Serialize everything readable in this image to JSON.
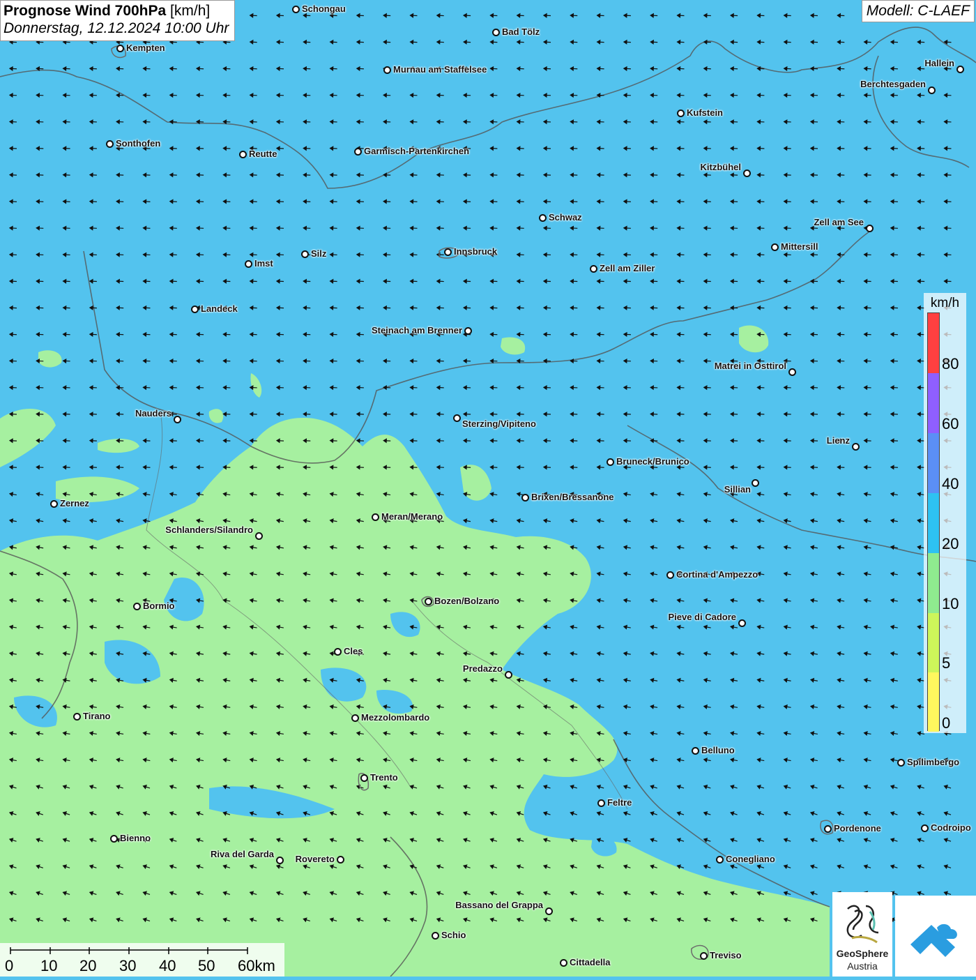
{
  "header": {
    "title_bold": "Prognose Wind 700hPa",
    "title_unit": "[km/h]",
    "datetime": "Donnerstag, 12.12.2024 10:00 Uhr",
    "model": "Modell: C-LAEF"
  },
  "legend": {
    "unit": "km/h",
    "labels": [
      "80",
      "60",
      "40",
      "20",
      "10",
      "5",
      "0"
    ],
    "colors": [
      "#ff4040",
      "#8f5fff",
      "#5b8ff6",
      "#2ec2f2",
      "#8feb8f",
      "#cdf55a",
      "#fff75e"
    ]
  },
  "scalebar": {
    "labels": [
      "0",
      "10",
      "20",
      "30",
      "40",
      "50",
      "60km"
    ]
  },
  "logos": {
    "geosphere_line1": "GeoSphere",
    "geosphere_line2": "Austria"
  },
  "wind": {
    "predominant_direction": "east",
    "field_color_blue": "#53c3ee",
    "field_color_green": "#a6f0a0"
  },
  "cities": [
    {
      "name": "Schongau"
    },
    {
      "name": "Bad Tölz"
    },
    {
      "name": "Kempten"
    },
    {
      "name": "Murnau am Staffelsee"
    },
    {
      "name": "Hallein"
    },
    {
      "name": "Berchtesgaden"
    },
    {
      "name": "Kufstein"
    },
    {
      "name": "Sonthofen"
    },
    {
      "name": "Reutte"
    },
    {
      "name": "Garmisch-Partenkirchen"
    },
    {
      "name": "Kitzbühel"
    },
    {
      "name": "Schwaz"
    },
    {
      "name": "Zell am See"
    },
    {
      "name": "Mittersill"
    },
    {
      "name": "Innsbruck"
    },
    {
      "name": "Silz"
    },
    {
      "name": "Imst"
    },
    {
      "name": "Zell am Ziller"
    },
    {
      "name": "Landeck"
    },
    {
      "name": "Steinach am Brenner"
    },
    {
      "name": "Matrei in Osttirol"
    },
    {
      "name": "Nauders"
    },
    {
      "name": "Sterzing/Vipiteno"
    },
    {
      "name": "Lienz"
    },
    {
      "name": "Bruneck/Brunico"
    },
    {
      "name": "Sillian"
    },
    {
      "name": "Brixen/Bressanone"
    },
    {
      "name": "Zernez"
    },
    {
      "name": "Meran/Merano"
    },
    {
      "name": "Schlanders/Silandro"
    },
    {
      "name": "Cortina d'Ampezzo"
    },
    {
      "name": "Bozen/Bolzano"
    },
    {
      "name": "Bormio"
    },
    {
      "name": "Pieve di Cadore"
    },
    {
      "name": "Cles"
    },
    {
      "name": "Predazzo"
    },
    {
      "name": "Tirano"
    },
    {
      "name": "Mezzolombardo"
    },
    {
      "name": "Belluno"
    },
    {
      "name": "Spilimbergo"
    },
    {
      "name": "Trento"
    },
    {
      "name": "Feltre"
    },
    {
      "name": "Bienno"
    },
    {
      "name": "Pordenone"
    },
    {
      "name": "Codroipo"
    },
    {
      "name": "Riva del Garda"
    },
    {
      "name": "Rovereto"
    },
    {
      "name": "Conegliano"
    },
    {
      "name": "Bassano del Grappa"
    },
    {
      "name": "Schio"
    },
    {
      "name": "Treviso"
    },
    {
      "name": "Cittadella"
    }
  ]
}
